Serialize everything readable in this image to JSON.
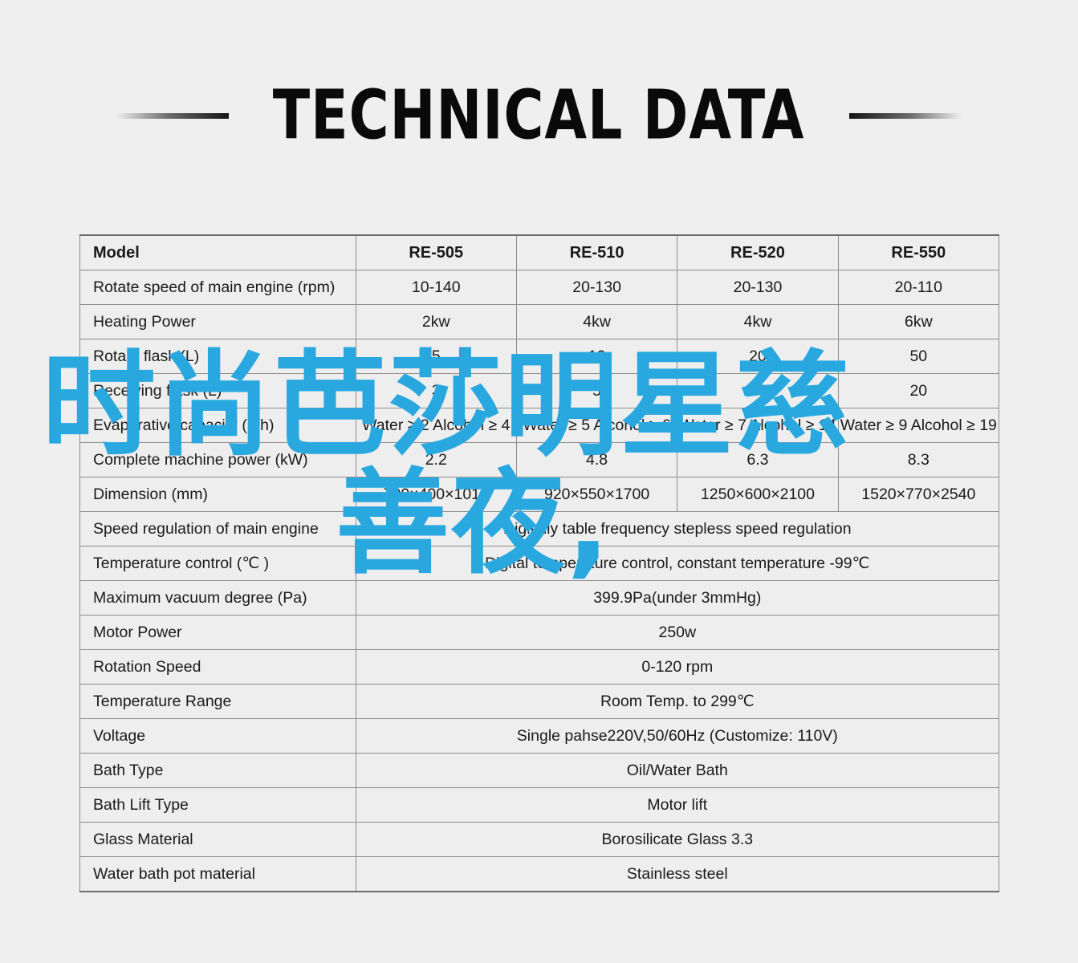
{
  "header": {
    "title": "TECHNICAL DATA",
    "rule_left": "tapered-rule-left",
    "rule_right": "tapered-rule-right"
  },
  "colors": {
    "background": "#efefef",
    "cell_background": "#eeeeee",
    "border": "#8c8c8c",
    "text": "#1a1a1a",
    "overlay_blue": "#29a8e0"
  },
  "overlay": {
    "line1": "时尚芭莎明星慈",
    "line2": "善夜,"
  },
  "table": {
    "columns": [
      "Model",
      "RE-505",
      "RE-510",
      "RE-520",
      "RE-550"
    ],
    "rows": [
      {
        "label": "Model",
        "header": true,
        "values": [
          "RE-505",
          "RE-510",
          "RE-520",
          "RE-550"
        ]
      },
      {
        "label": "Rotate speed of main engine (rpm)",
        "values": [
          "10-140",
          "20-130",
          "20-130",
          "20-110"
        ]
      },
      {
        "label": "Heating Power",
        "values": [
          "2kw",
          "4kw",
          "4kw",
          "6kw"
        ]
      },
      {
        "label": "Rotary flask (L)",
        "values": [
          "5",
          "10",
          "20",
          "50"
        ]
      },
      {
        "label": "Receiving flask (L)",
        "values": [
          "3",
          "5",
          "10",
          "20"
        ]
      },
      {
        "label": "Evaporative capacity (L/h)",
        "values": [
          "Water ≥ 2 Alcohol ≥ 4",
          "Water ≥ 5 Alcohol ≥ 6",
          "Water ≥ 7 Alcohol ≥ 14",
          "Water ≥ 9 Alcohol ≥ 19"
        ]
      },
      {
        "label": "Complete machine power (kW)",
        "values": [
          "2.2",
          "4.8",
          "6.3",
          "8.3"
        ]
      },
      {
        "label": "Dimension (mm)",
        "values": [
          "700×400×1010",
          "920×550×1700",
          "1250×600×2100",
          "1520×770×2540"
        ]
      },
      {
        "label": "Speed regulation of main engine",
        "span": "Digitally table frequency stepless speed regulation"
      },
      {
        "label": "Temperature control (℃ )",
        "span": "Digital temperature control, constant temperature -99℃"
      },
      {
        "label": "Maximum vacuum degree (Pa)",
        "span": "399.9Pa(under 3mmHg)"
      },
      {
        "label": "Motor Power",
        "span": "250w"
      },
      {
        "label": "Rotation Speed",
        "span": "0-120 rpm"
      },
      {
        "label": "Temperature Range",
        "span": "Room Temp. to 299℃"
      },
      {
        "label": "Voltage",
        "span": "Single pahse220V,50/60Hz (Customize: 110V)"
      },
      {
        "label": "Bath Type",
        "span": "Oil/Water Bath"
      },
      {
        "label": "Bath Lift Type",
        "span": "Motor lift"
      },
      {
        "label": "Glass Material",
        "span": "Borosilicate Glass 3.3"
      },
      {
        "label": "Water bath pot material",
        "span": "Stainless steel"
      }
    ]
  }
}
